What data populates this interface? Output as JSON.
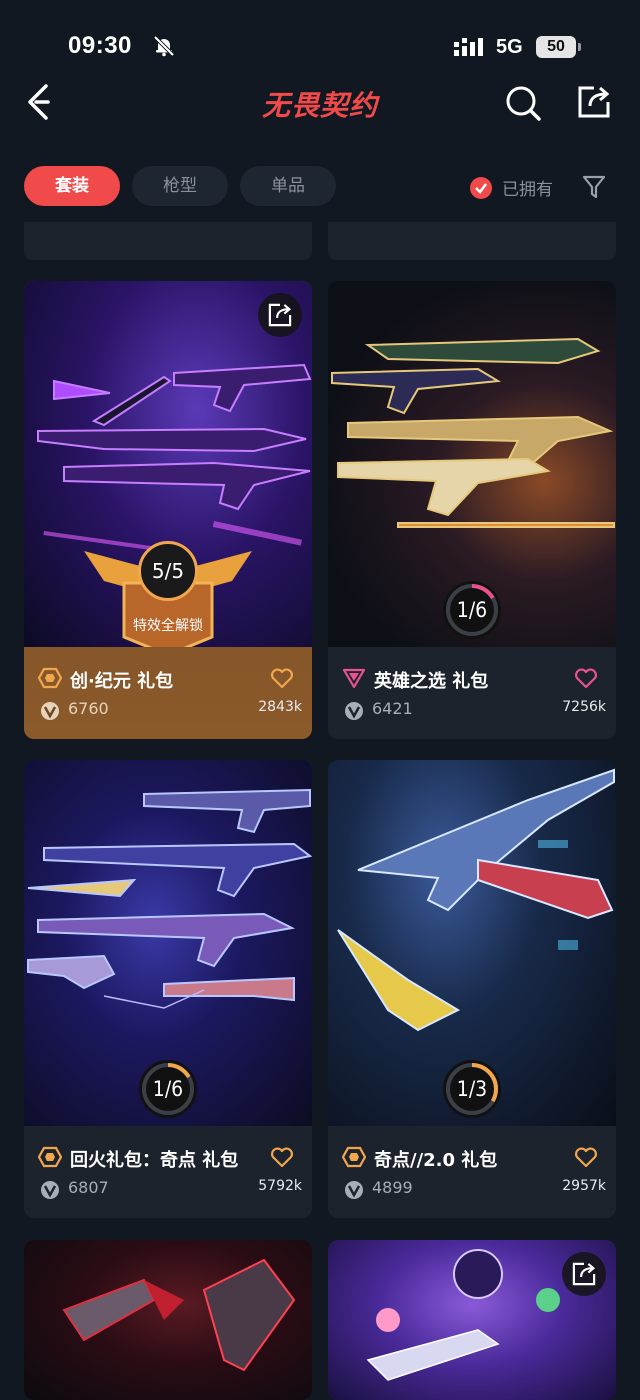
{
  "status": {
    "time": "09:30",
    "network": "5G",
    "battery": "50"
  },
  "header": {
    "title": "无畏契约"
  },
  "tabs": [
    {
      "label": "套装",
      "active": true
    },
    {
      "label": "枪型",
      "active": false
    },
    {
      "label": "单品",
      "active": false
    }
  ],
  "filters": {
    "owned_label": "已拥有"
  },
  "cards": [
    {
      "name": "创·纪元 礼包",
      "price": "6760",
      "likes": "2843k",
      "progress": "5/5",
      "progress_fraction": 1.0,
      "badge_label": "特效全解锁",
      "tier": "ultra",
      "accent": "#f2a64e"
    },
    {
      "name": "英雄之选 礼包",
      "price": "6421",
      "likes": "7256k",
      "progress": "1/6",
      "progress_fraction": 0.1667,
      "tier": "exclusive",
      "accent": "#e8538f"
    },
    {
      "name": "回火礼包：奇点 礼包",
      "price": "6807",
      "likes": "5792k",
      "progress": "1/6",
      "progress_fraction": 0.1667,
      "tier": "ultra",
      "accent": "#f2a64e"
    },
    {
      "name": "奇点//2.0 礼包",
      "price": "4899",
      "likes": "2957k",
      "progress": "1/3",
      "progress_fraction": 0.3333,
      "tier": "ultra",
      "accent": "#f2a64e"
    }
  ],
  "colors": {
    "brand": "#f04a4a",
    "background": "#111821",
    "card": "#1c232d",
    "gold_card": "#8b5a2b"
  },
  "icons": [
    "back-icon",
    "search-icon",
    "share-icon",
    "check-icon",
    "filter-icon",
    "tier-icon",
    "heart-icon",
    "vp-coin-icon",
    "mute-bell-icon",
    "signal-icon"
  ]
}
